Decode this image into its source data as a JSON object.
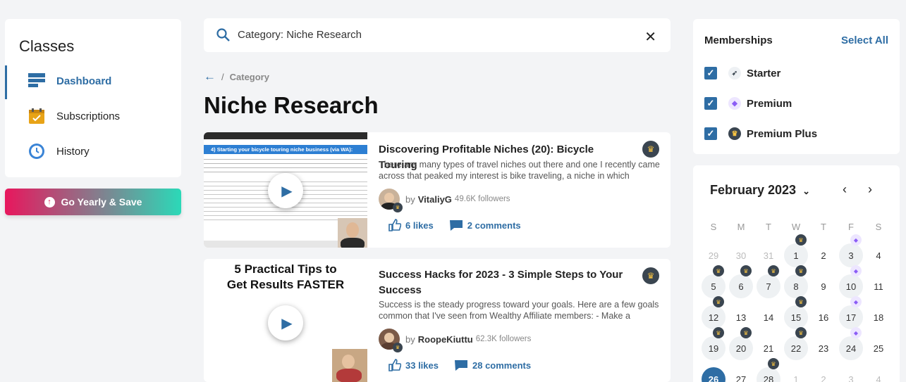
{
  "sidebar": {
    "title": "Classes",
    "items": [
      {
        "label": "Dashboard",
        "icon": "dashboard-icon",
        "active": true
      },
      {
        "label": "Subscriptions",
        "icon": "calendar-icon"
      },
      {
        "label": "History",
        "icon": "clock-icon"
      }
    ],
    "promo_label": "Go Yearly & Save"
  },
  "search": {
    "value": "Category: Niche Research"
  },
  "breadcrumb": {
    "separator": "/",
    "category": "Category"
  },
  "page_title": "Niche Research",
  "posts": [
    {
      "title": "Discovering Profitable Niches (20): Bicycle Touring",
      "excerpt": "There are many types of travel niches out there and one I recently came across that peaked my interest is bike traveling, a niche in which",
      "by": "by",
      "author": "VitaliyG",
      "followers": "49.6K followers",
      "likes": "6 likes",
      "comments": "2  comments",
      "thumb_text": "4) Starting your bicycle touring niche business (via WA):"
    },
    {
      "title": "Success Hacks for 2023 - 3 Simple Steps to Your Success",
      "excerpt": "Success is the steady progress toward your goals. Here are a few goals common that I've seen from Wealthy Affiliate members: - Make a",
      "by": "by",
      "author": "RoopeKiuttu",
      "followers": "62.3K followers",
      "likes": "33 likes",
      "comments": "28  comments",
      "thumb_line1": "5 Practical Tips to",
      "thumb_line2": "Get Results FASTER"
    }
  ],
  "memberships": {
    "title": "Memberships",
    "select_all": "Select All",
    "items": [
      {
        "label": "Starter",
        "checked": true,
        "icon": "rocket-icon"
      },
      {
        "label": "Premium",
        "checked": true,
        "icon": "gem-icon"
      },
      {
        "label": "Premium Plus",
        "checked": true,
        "icon": "crown-icon"
      }
    ]
  },
  "calendar": {
    "month": "February 2023",
    "dow": [
      "S",
      "M",
      "T",
      "W",
      "T",
      "F",
      "S"
    ],
    "weeks": [
      [
        "29",
        "30",
        "31",
        "1",
        "2",
        "3",
        "4"
      ],
      [
        "5",
        "6",
        "7",
        "8",
        "9",
        "10",
        "11"
      ],
      [
        "12",
        "13",
        "14",
        "15",
        "16",
        "17",
        "18"
      ],
      [
        "19",
        "20",
        "21",
        "22",
        "23",
        "24",
        "25"
      ],
      [
        "26",
        "27",
        "28",
        "1",
        "2",
        "3",
        "4"
      ]
    ]
  },
  "colors": {
    "accent": "#2e6da4",
    "crown_bg": "#3a4550",
    "crown": "#f5c242",
    "gem": "#8b5cf6"
  }
}
